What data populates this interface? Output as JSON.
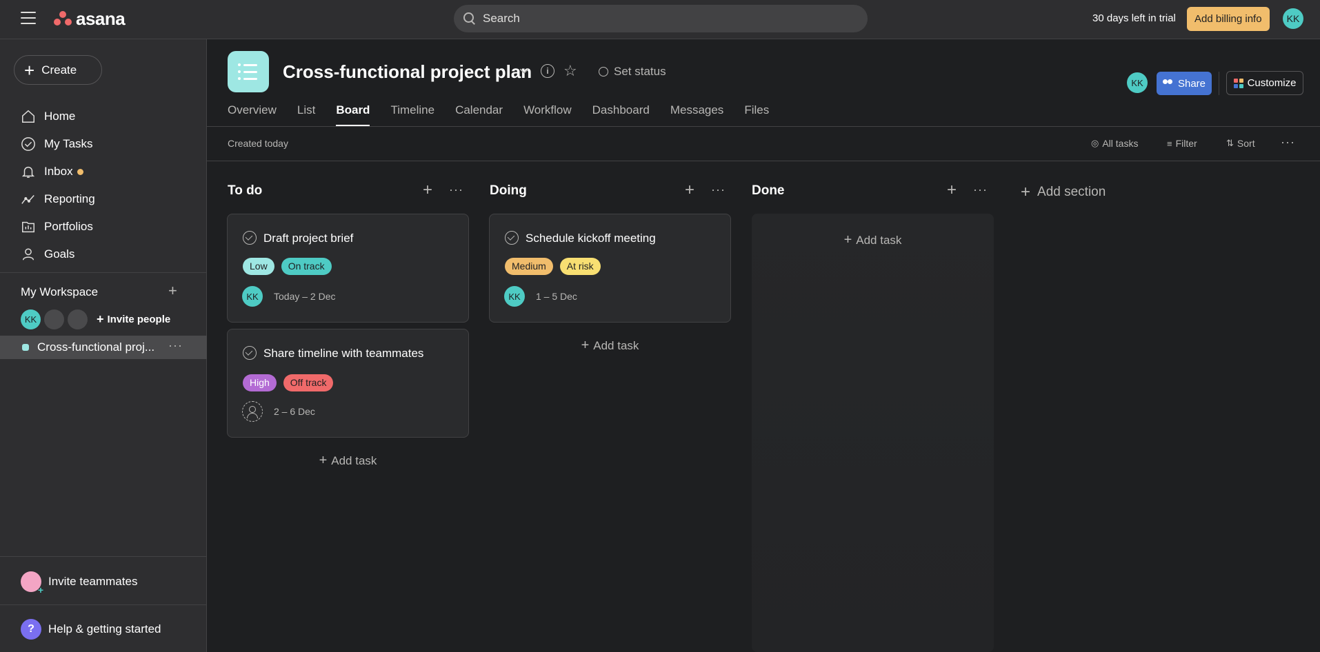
{
  "topbar": {
    "logo_text": "asana",
    "search_placeholder": "Search",
    "trial_text": "30 days left in trial",
    "billing_label": "Add billing info",
    "user_initials": "KK"
  },
  "sidebar": {
    "create_label": "Create",
    "nav": [
      {
        "label": "Home",
        "icon": "home-icon"
      },
      {
        "label": "My Tasks",
        "icon": "check-circle-icon"
      },
      {
        "label": "Inbox",
        "icon": "bell-icon"
      },
      {
        "label": "Reporting",
        "icon": "chart-line-icon"
      },
      {
        "label": "Portfolios",
        "icon": "portfolio-icon"
      },
      {
        "label": "Goals",
        "icon": "person-icon"
      }
    ],
    "workspace_title": "My Workspace",
    "workspace_member_initials": "KK",
    "invite_people_label": "Invite people",
    "project_name": "Cross-functional proj...",
    "invite_teammates_label": "Invite teammates",
    "help_label": "Help & getting started"
  },
  "project": {
    "title": "Cross-functional project plan",
    "set_status_label": "Set status",
    "member_initials": "KK",
    "share_label": "Share",
    "customize_label": "Customize",
    "tabs": [
      "Overview",
      "List",
      "Board",
      "Timeline",
      "Calendar",
      "Workflow",
      "Dashboard",
      "Messages",
      "Files"
    ],
    "active_tab": "Board"
  },
  "toolbar": {
    "created_text": "Created today",
    "all_tasks_label": "All tasks",
    "filter_label": "Filter",
    "sort_label": "Sort"
  },
  "board": {
    "add_task_label": "Add task",
    "add_section_label": "Add section",
    "columns": [
      {
        "title": "To do",
        "tasks": [
          {
            "name": "Draft project brief",
            "tags": [
              {
                "label": "Low",
                "color": "#9ee7e3"
              },
              {
                "label": "On track",
                "color": "#4ecbc4"
              }
            ],
            "assignee": "KK",
            "dates": "Today – 2 Dec"
          },
          {
            "name": "Share timeline with teammates",
            "tags": [
              {
                "label": "High",
                "color": "#b36bd4"
              },
              {
                "label": "Off track",
                "color": "#f06a6a"
              }
            ],
            "assignee": "",
            "dates": "2 – 6 Dec"
          }
        ]
      },
      {
        "title": "Doing",
        "tasks": [
          {
            "name": "Schedule kickoff meeting",
            "tags": [
              {
                "label": "Medium",
                "color": "#f1bd6c"
              },
              {
                "label": "At risk",
                "color": "#f8df72"
              }
            ],
            "assignee": "KK",
            "dates": "1 – 5 Dec"
          }
        ]
      },
      {
        "title": "Done",
        "tasks": []
      }
    ]
  },
  "colors": {
    "accent_blue": "#4573d2",
    "billing_orange": "#f1bd6c",
    "avatar_teal": "#4ecbc4",
    "project_teal": "#9ee7e3"
  }
}
